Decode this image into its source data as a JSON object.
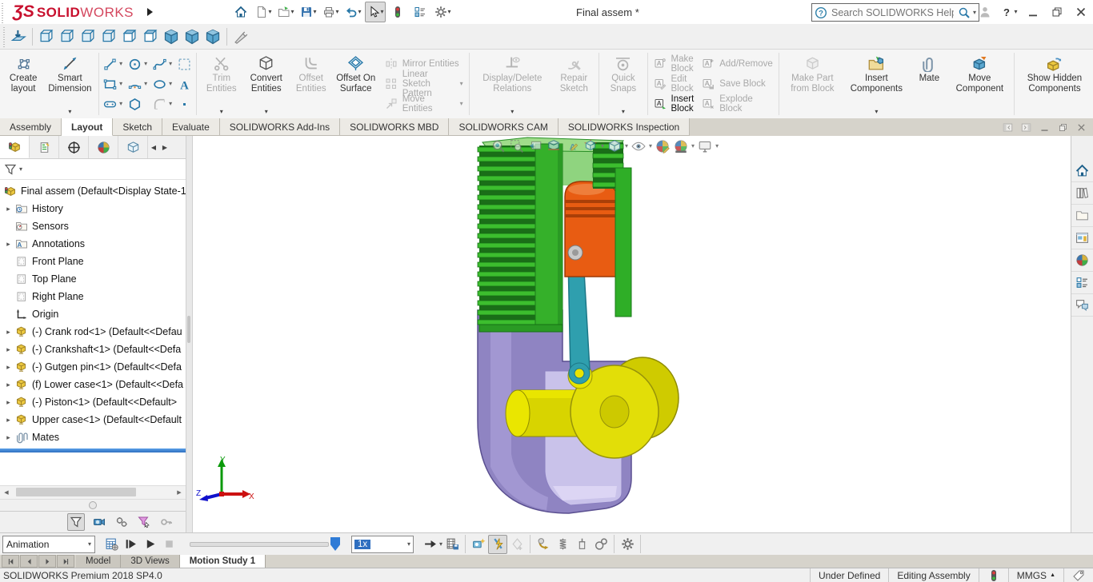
{
  "titlebar": {
    "logo_mark": "ƷS",
    "logo_bold": "SOLID",
    "logo_light": "WORKS",
    "document_title": "Final assem *",
    "search_placeholder": "Search SOLIDWORKS Help"
  },
  "quickbar": {
    "icons": [
      "normal-to",
      "|",
      "view-front",
      "view-back",
      "view-left",
      "view-right",
      "view-top",
      "view-bottom",
      "view-isometric",
      "view-dimetric",
      "view-trimetric",
      "|",
      "probe-tool"
    ]
  },
  "ribbon": {
    "create_layout": "Create layout",
    "smart_dimension": "Smart Dimension",
    "trim_entities": "Trim Entities",
    "convert_entities": "Convert Entities",
    "offset_entities": "Offset Entities",
    "offset_on_surface": "Offset On Surface",
    "mirror_entities": "Mirror Entities",
    "linear_sketch_pattern": "Linear Sketch Pattern",
    "move_entities": "Move Entities",
    "display_delete_relations": "Display/Delete Relations",
    "repair_sketch": "Repair Sketch",
    "quick_snaps": "Quick Snaps",
    "make_block": "Make Block",
    "edit_block": "Edit Block",
    "insert_block": "Insert Block",
    "add_remove": "Add/Remove",
    "save_block": "Save Block",
    "explode_block": "Explode Block",
    "make_part_from_block": "Make Part from Block",
    "insert_components": "Insert Components",
    "mate": "Mate",
    "move_component": "Move Component",
    "show_hidden_components": "Show Hidden Components"
  },
  "ribbon_tabs": {
    "items": [
      "Assembly",
      "Layout",
      "Sketch",
      "Evaluate",
      "SOLIDWORKS Add-Ins",
      "SOLIDWORKS MBD",
      "SOLIDWORKS CAM",
      "SOLIDWORKS Inspection"
    ],
    "active": "Layout"
  },
  "feature_tree": {
    "root_label": "Final assem  (Default<Display State-1>",
    "items": [
      {
        "label": "History",
        "icon": "folder-history",
        "expandable": true
      },
      {
        "label": "Sensors",
        "icon": "folder-sensors",
        "expandable": false
      },
      {
        "label": "Annotations",
        "icon": "folder-annotations",
        "expandable": true
      },
      {
        "label": "Front Plane",
        "icon": "plane",
        "expandable": false
      },
      {
        "label": "Top Plane",
        "icon": "plane",
        "expandable": false
      },
      {
        "label": "Right Plane",
        "icon": "plane",
        "expandable": false
      },
      {
        "label": "Origin",
        "icon": "origin",
        "expandable": false
      },
      {
        "label": "(-) Crank rod<1> (Default<<Defau",
        "icon": "component",
        "expandable": true
      },
      {
        "label": "(-) Crankshaft<1> (Default<<Defa",
        "icon": "component",
        "expandable": true
      },
      {
        "label": "(-) Gutgen pin<1> (Default<<Defa",
        "icon": "component",
        "expandable": true
      },
      {
        "label": "(f) Lower case<1> (Default<<Defa",
        "icon": "component",
        "expandable": true
      },
      {
        "label": "(-) Piston<1> (Default<<Default>",
        "icon": "component",
        "expandable": true
      },
      {
        "label": "Upper case<1> (Default<<Default",
        "icon": "component",
        "expandable": true
      },
      {
        "label": "Mates",
        "icon": "mates",
        "expandable": true
      }
    ]
  },
  "heads_up": {
    "icons": [
      "zoom-to-fit",
      "zoom-to-area",
      "previous-view",
      "section-view",
      "dynamic-annotation-views",
      "view-orientation",
      "display-style",
      "hide-show-items",
      "edit-appearance",
      "apply-scene",
      "view-settings"
    ]
  },
  "viewport": {
    "triad": {
      "x_label": "X",
      "y_label": "Y",
      "z_label": "Z"
    }
  },
  "task_pane": {
    "icons": [
      "solidworks-resources",
      "design-library",
      "file-explorer",
      "view-palette",
      "appearances-scenes",
      "custom-properties",
      "solidworks-forum"
    ]
  },
  "motion_panel": {
    "study_type": "Animation",
    "playback_speed": "1x",
    "filter_icons": [
      "filter-no",
      "filter-animated",
      "filter-driving",
      "filter-selected",
      "filter-results"
    ],
    "nav_icons": [
      "nav-first",
      "nav-prev",
      "nav-next",
      "nav-last"
    ],
    "doc_tabs": [
      "Model",
      "3D Views",
      "Motion Study 1"
    ],
    "active_doc_tab": "Motion Study 1"
  },
  "status_bar": {
    "product": "SOLIDWORKS Premium 2018 SP4.0",
    "constraint_status": "Under Defined",
    "edit_mode": "Editing Assembly",
    "units": "MMGS"
  },
  "colors": {
    "accent_blue": "#2878a8",
    "selection_blue": "#2f7bd6",
    "model_green": "#3cbe2e",
    "model_orange": "#e85c12",
    "model_yellow": "#e2de08",
    "model_purple": "#8f84c2",
    "model_teal": "#2f9fae"
  }
}
